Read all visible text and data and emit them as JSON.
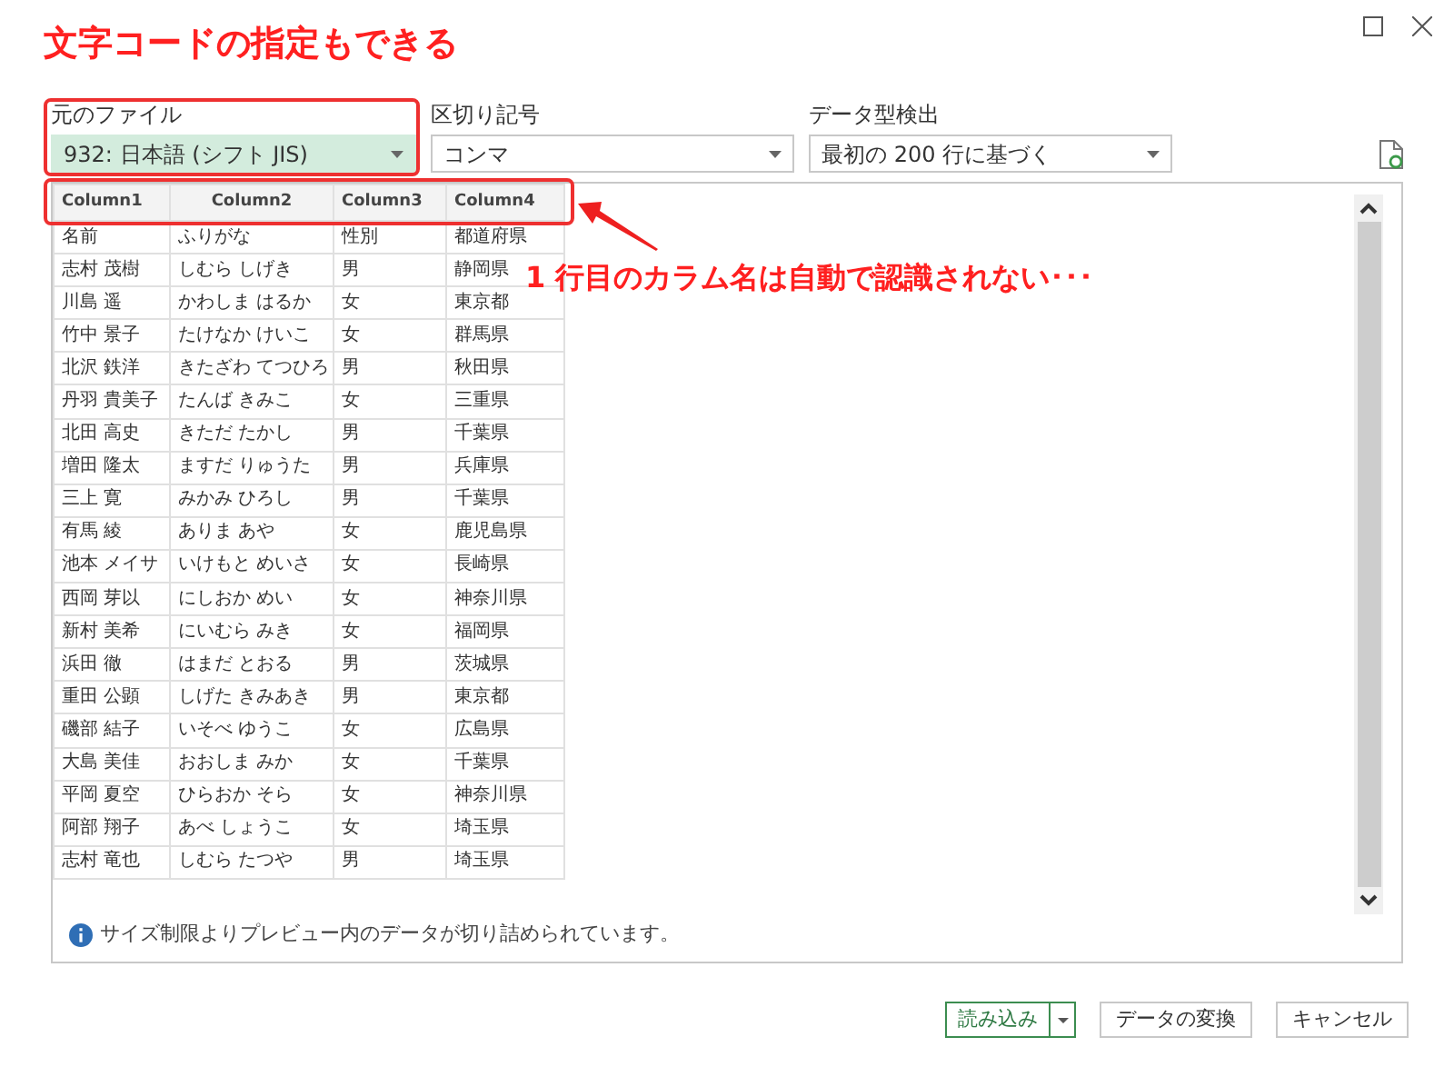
{
  "options": [
    {
      "label": "元のファイル",
      "value": "932: 日本語 (シフト JIS)",
      "selected": true
    },
    {
      "label": "区切り記号",
      "value": "コンマ",
      "selected": false
    },
    {
      "label": "データ型検出",
      "value": "最初の 200 行に基づく",
      "selected": false
    }
  ],
  "table": {
    "columns": [
      "Column1",
      "Column2",
      "Column3",
      "Column4"
    ],
    "rows": [
      [
        "名前",
        "ふりがな",
        "性別",
        "都道府県"
      ],
      [
        "志村 茂樹",
        "しむら しげき",
        "男",
        "静岡県"
      ],
      [
        "川島 遥",
        "かわしま はるか",
        "女",
        "東京都"
      ],
      [
        "竹中 景子",
        "たけなか けいこ",
        "女",
        "群馬県"
      ],
      [
        "北沢 鉄洋",
        "きたざわ てつひろ",
        "男",
        "秋田県"
      ],
      [
        "丹羽 貴美子",
        "たんば きみこ",
        "女",
        "三重県"
      ],
      [
        "北田 高史",
        "きただ たかし",
        "男",
        "千葉県"
      ],
      [
        "増田 隆太",
        "ますだ りゅうた",
        "男",
        "兵庫県"
      ],
      [
        "三上 寛",
        "みかみ ひろし",
        "男",
        "千葉県"
      ],
      [
        "有馬 綾",
        "ありま あや",
        "女",
        "鹿児島県"
      ],
      [
        "池本 メイサ",
        "いけもと めいさ",
        "女",
        "長崎県"
      ],
      [
        "西岡 芽以",
        "にしおか めい",
        "女",
        "神奈川県"
      ],
      [
        "新村 美希",
        "にいむら みき",
        "女",
        "福岡県"
      ],
      [
        "浜田 徹",
        "はまだ とおる",
        "男",
        "茨城県"
      ],
      [
        "重田 公顕",
        "しげた きみあき",
        "男",
        "東京都"
      ],
      [
        "磯部 結子",
        "いそべ ゆうこ",
        "女",
        "広島県"
      ],
      [
        "大島 美佳",
        "おおしま みか",
        "女",
        "千葉県"
      ],
      [
        "平岡 夏空",
        "ひらおか そら",
        "女",
        "神奈川県"
      ],
      [
        "阿部 翔子",
        "あべ しょうこ",
        "女",
        "埼玉県"
      ],
      [
        "志村 竜也",
        "しむら たつや",
        "男",
        "埼玉県"
      ]
    ]
  },
  "info": "サイズ制限よりプレビュー内のデータが切り詰められています。",
  "buttons": [
    {
      "label": "読み込み",
      "kind": "split"
    },
    {
      "label": "データの変換",
      "kind": "plain"
    },
    {
      "label": "キャンセル",
      "kind": "plain"
    }
  ],
  "annotations": [
    {
      "kind": "caption",
      "text": "文字コードの指定もできる"
    },
    {
      "kind": "callout",
      "text": "1 行目のカラム名は自動で認識されない･･･"
    }
  ]
}
